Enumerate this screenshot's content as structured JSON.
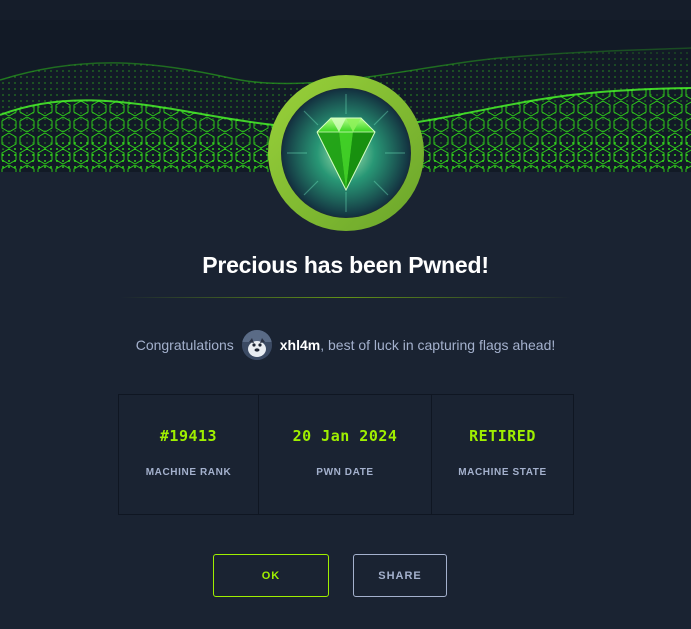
{
  "modal": {
    "title": "Precious has been Pwned!",
    "congrats_prefix": "Congratulations",
    "username": "xhl4m",
    "congrats_suffix": ", best of luck in capturing flags ahead!",
    "badge_icon": "emerald-gem-icon",
    "accent_color": "#9fef00"
  },
  "stats": [
    {
      "value": "#19413",
      "label": "MACHINE RANK"
    },
    {
      "value": "20 Jan 2024",
      "label": "PWN DATE"
    },
    {
      "value": "RETIRED",
      "label": "MACHINE STATE"
    }
  ],
  "buttons": {
    "ok_label": "OK",
    "share_label": "SHARE"
  }
}
